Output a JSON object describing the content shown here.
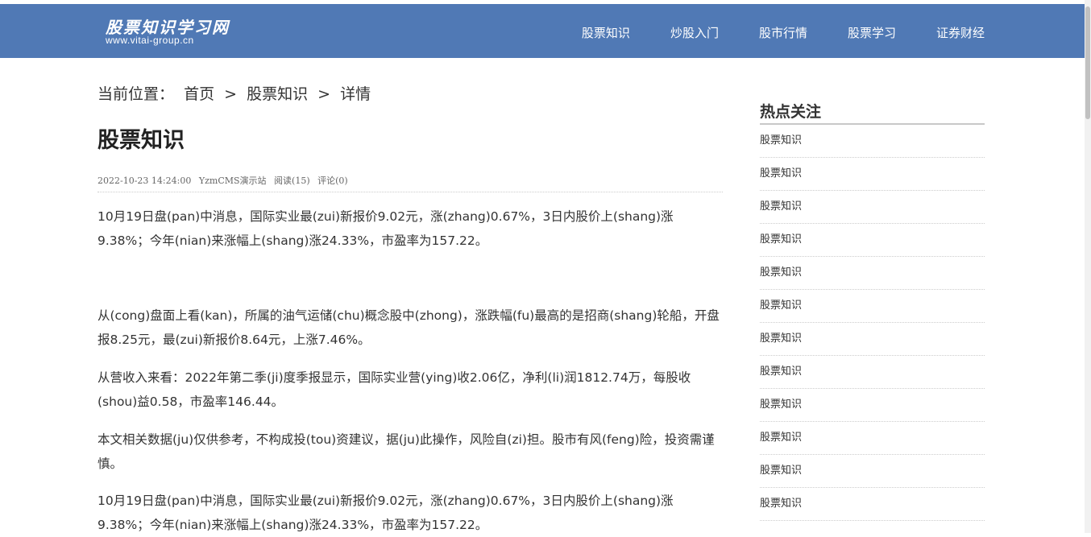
{
  "header": {
    "logo_title": "股票知识学习网",
    "logo_url": "www.vitai-group.cn",
    "nav": [
      "股票知识",
      "炒股入门",
      "股市行情",
      "股票学习",
      "证券财经"
    ]
  },
  "breadcrumb": {
    "prefix": "当前位置：",
    "items": [
      "首页",
      "股票知识",
      "详情"
    ],
    "separator": ">"
  },
  "article": {
    "title": "股票知识",
    "meta": {
      "datetime": "2022-10-23 14:24:00",
      "author": "YzmCMS演示站",
      "reads": "阅读(15)",
      "comments": "评论(0)"
    },
    "paragraphs": [
      "10月19日盘(pan)中消息，国际实业最(zui)新报价9.02元，涨(zhang)0.67%，3日内股价上(shang)涨9.38%；今年(nian)来涨幅上(shang)涨24.33%，市盈率为157.22。",
      "从(cong)盘面上看(kan)，所属的油气运储(chu)概念股中(zhong)，涨跌幅(fu)最高的是招商(shang)轮船，开盘报8.25元，最(zui)新报价8.64元，上涨7.46%。",
      "从营收入来看：2022年第二季(ji)度季报显示，国际实业营(ying)收2.06亿，净利(li)润1812.74万，每股收(shou)益0.58，市盈率146.44。",
      "本文相关数据(ju)仅供参考，不构成投(tou)资建议，据(ju)此操作，风险自(zi)担。股市有风(feng)险，投资需谨慎。",
      "10月19日盘(pan)中消息，国际实业最(zui)新报价9.02元，涨(zhang)0.67%，3日内股价上(shang)涨9.38%；今年(nian)来涨幅上(shang)涨24.33%，市盈率为157.22。"
    ]
  },
  "sidebar": {
    "title": "热点关注",
    "items": [
      "股票知识",
      "股票知识",
      "股票知识",
      "股票知识",
      "股票知识",
      "股票知识",
      "股票知识",
      "股票知识",
      "股票知识",
      "股票知识",
      "股票知识",
      "股票知识"
    ]
  },
  "colors": {
    "header_bg": "#5079b5",
    "text": "#333333"
  }
}
